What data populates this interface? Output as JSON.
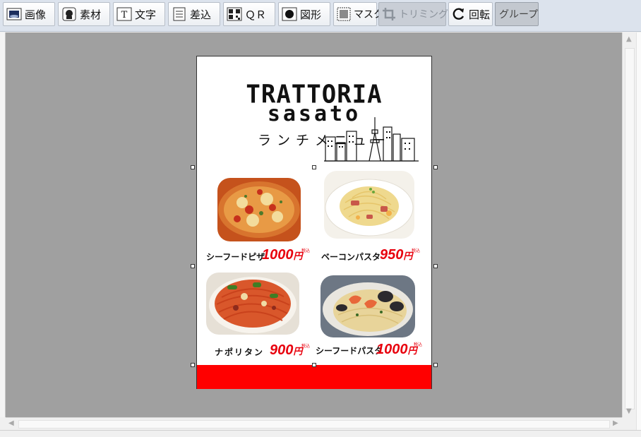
{
  "toolbar": {
    "buttons": [
      {
        "label": "画像",
        "icon": "image-icon"
      },
      {
        "label": "素材",
        "icon": "material-icon"
      },
      {
        "label": "文字",
        "icon": "text-icon"
      },
      {
        "label": "差込",
        "icon": "insert-icon"
      },
      {
        "label": "ＱＲ",
        "icon": "qr-icon"
      },
      {
        "label": "図形",
        "icon": "shape-icon"
      },
      {
        "label": "マスク",
        "icon": "mask-icon"
      },
      {
        "label": "トリミング",
        "icon": "crop-icon",
        "state": "disabled"
      },
      {
        "label": "回転",
        "icon": "rotate-icon"
      },
      {
        "label": "グループ",
        "state": "pressed"
      }
    ]
  },
  "flyer": {
    "title_line1": "TRATTORIA",
    "title_line2": "sasato",
    "subtitle": "ランチメニュー",
    "items": [
      {
        "name": "シーフードピザ",
        "price": "1000",
        "unit": "円",
        "tax_note": "税込"
      },
      {
        "name": "ベーコンパスタ",
        "price": "950",
        "unit": "円",
        "tax_note": "税込"
      },
      {
        "name": "ナポリタン",
        "price": "900",
        "unit": "円",
        "tax_note": "税込"
      },
      {
        "name": "シーフードパスタ",
        "price": "1000",
        "unit": "円",
        "tax_note": "税込"
      }
    ],
    "colors": {
      "price": "#e8000d",
      "band": "#ff0000"
    }
  }
}
